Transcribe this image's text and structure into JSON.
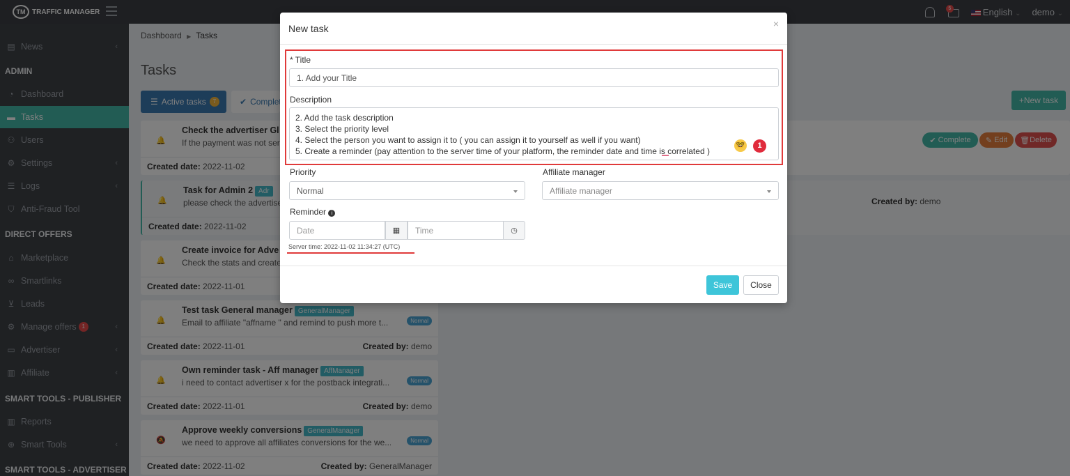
{
  "app": {
    "name": "TRAFFIC MANAGER",
    "notifications_count": "5",
    "language": "English",
    "user": "demo"
  },
  "sidebar": {
    "items": [
      {
        "label": "News",
        "icon": "newspaper-icon"
      },
      {
        "header": "ADMIN"
      },
      {
        "label": "Dashboard",
        "icon": "dashboard-icon"
      },
      {
        "label": "Tasks",
        "icon": "tasks-icon",
        "active": true
      },
      {
        "label": "Users",
        "icon": "users-icon"
      },
      {
        "label": "Settings",
        "icon": "gear-icon"
      },
      {
        "label": "Logs",
        "icon": "list-icon"
      },
      {
        "label": "Anti-Fraud Tool",
        "icon": "shield-icon"
      },
      {
        "header": "DIRECT OFFERS"
      },
      {
        "label": "Marketplace",
        "icon": "store-icon"
      },
      {
        "label": "Smartlinks",
        "icon": "link-icon"
      },
      {
        "label": "Leads",
        "icon": "cart-icon"
      },
      {
        "label": "Manage offers",
        "icon": "gear-icon",
        "badge": "1"
      },
      {
        "label": "Advertiser",
        "icon": "card-icon"
      },
      {
        "label": "Affiliate",
        "icon": "bar-chart-icon"
      },
      {
        "header": "SMART TOOLS - PUBLISHER"
      },
      {
        "label": "Reports",
        "icon": "bar-chart-icon"
      },
      {
        "label": "Smart Tools",
        "icon": "globe-icon"
      },
      {
        "header": "SMART TOOLS - ADVERTISER"
      }
    ]
  },
  "breadcrumb": {
    "root": "Dashboard",
    "current": "Tasks"
  },
  "page": {
    "title": "Tasks",
    "active_tasks_label": "Active tasks",
    "active_tasks_count": "7",
    "completed_label": "Complet",
    "new_task_label": "New task"
  },
  "tasks": [
    {
      "title": "Check the advertiser Gl",
      "desc": "If the payment was not ser",
      "created_label": "Created date:",
      "created": "2022-11-02"
    },
    {
      "title": "Task for Admin 2",
      "tag": "Adr",
      "desc": "please check the advertiser",
      "created_label": "Created date:",
      "created": "2022-11-02"
    },
    {
      "title": "Create invoice for Adve",
      "desc": "Check the stats and create",
      "created_label": "Created date:",
      "created": "2022-11-01"
    },
    {
      "title": "Test task General manager",
      "tag": "GeneralManager",
      "desc": "Email to affiliate \"affname \" and remind to push more t...",
      "priority": "Normal",
      "created_label": "Created date:",
      "created": "2022-11-01",
      "by_label": "Created by:",
      "by": "demo"
    },
    {
      "title": "Own reminder task - Aff manager",
      "tag": "AffManager",
      "desc": "i need to contact advertiser x for the postback integrati...",
      "priority": "Normal",
      "created_label": "Created date:",
      "created": "2022-11-01",
      "by_label": "Created by:",
      "by": "demo"
    },
    {
      "title": "Approve weekly conversions",
      "tag": "GeneralManager",
      "desc": "we need to approve all affiliates conversions for the we...",
      "priority": "Normal",
      "created_label": "Created date:",
      "created": "2022-11-02",
      "by_label": "Created by:",
      "by": "GeneralManager"
    }
  ],
  "task_actions": {
    "complete": "Complete",
    "edit": "Edit",
    "delete": "Delete"
  },
  "second_row": {
    "by_label": "Created by:",
    "by": "demo"
  },
  "modal": {
    "title": "New task",
    "close_x": "×",
    "title_label": "* Title",
    "title_value": "1. Add your Title",
    "description_label": "Description",
    "description_lines": [
      "2. Add the task description",
      "3. Select the priority level",
      "4. Select the person you want to assign it to ( you can assign it to yourself as well if you want)",
      "5. Create a reminder (pay attention to the server time of your platform, the reminder date and time is correlated )"
    ],
    "step_badge": "1",
    "priority_label": "Priority",
    "priority_value": "Normal",
    "affiliate_manager_label": "Affiliate manager",
    "affiliate_manager_placeholder": "Affiliate manager",
    "reminder_label": "Reminder",
    "date_placeholder": "Date",
    "time_placeholder": "Time",
    "server_time": "Server time: 2022-11-02 11:34:27 (UTC)",
    "save_label": "Save",
    "close_label": "Close"
  },
  "colors": {
    "accent": "#44b8a8",
    "primary": "#3a7ab2",
    "save": "#3ec5d9",
    "highlight": "#e03a3a"
  }
}
